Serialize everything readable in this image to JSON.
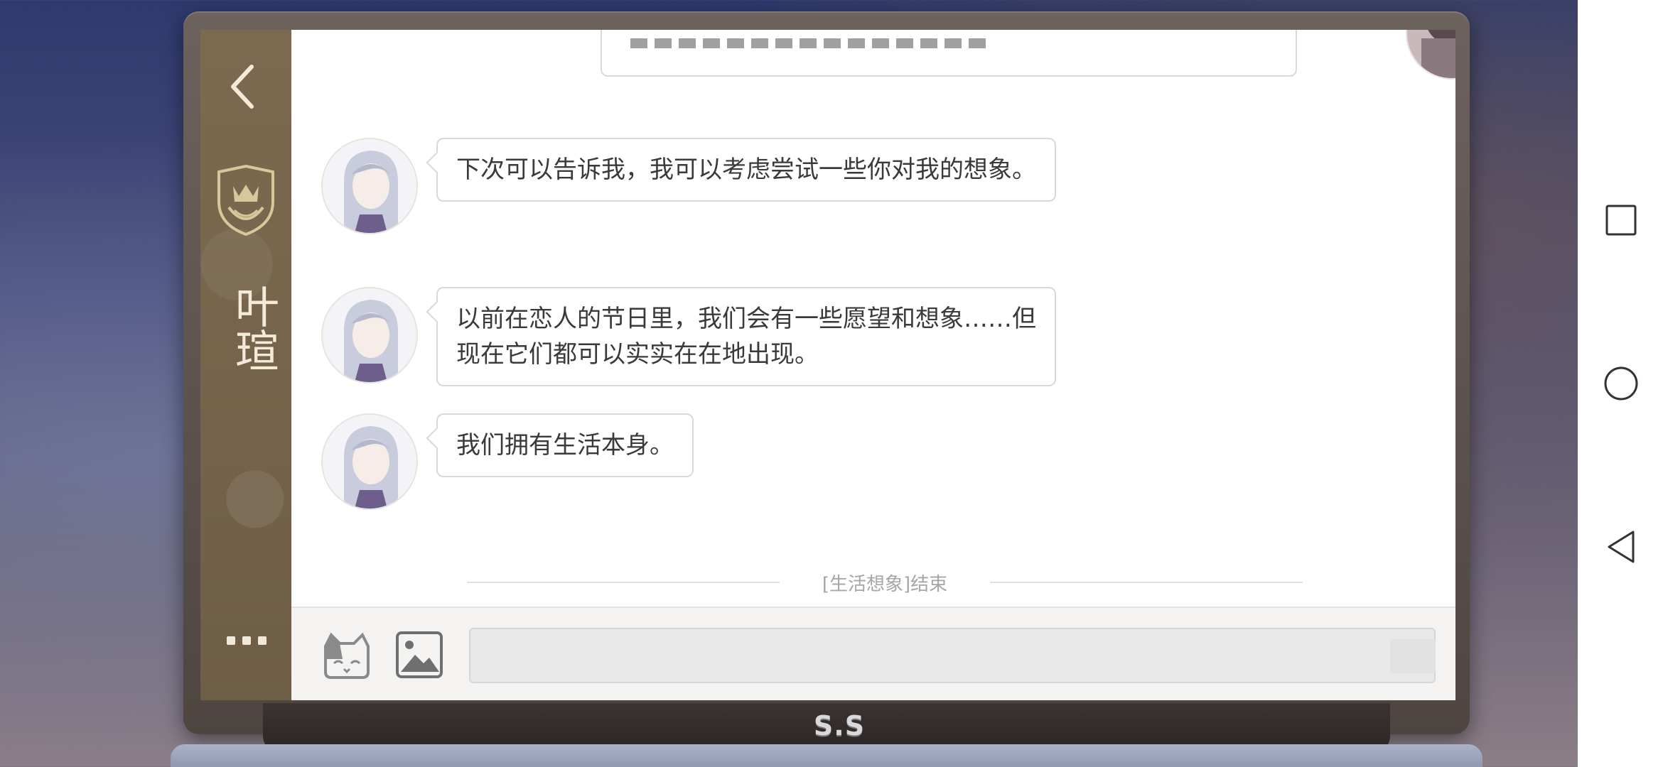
{
  "contact": {
    "name": "叶瑄"
  },
  "messages": [
    {
      "sender": "叶瑄",
      "text": "下次可以告诉我，我可以考虑尝试一些你对我的想象。"
    },
    {
      "sender": "叶瑄",
      "text_line1": "以前在恋人的节日里，我们会有一些愿望和想象……但",
      "text_line2": "现在它们都可以实实在在地出现。"
    },
    {
      "sender": "叶瑄",
      "text": "我们拥有生活本身。"
    }
  ],
  "divider": {
    "label": "[生活想象]结束"
  },
  "device": {
    "brand": "S.S"
  },
  "input": {
    "value": ""
  },
  "colors": {
    "sidebar": "#7c6a50",
    "bubble_border": "#dcd8d3",
    "text": "#3a3a3a",
    "divider_text": "#a6a6a6"
  },
  "icons": [
    "back-arrow-icon",
    "crest-icon",
    "more-icon",
    "sticker-icon",
    "image-icon",
    "recent-apps-icon",
    "home-icon",
    "back-icon"
  ]
}
